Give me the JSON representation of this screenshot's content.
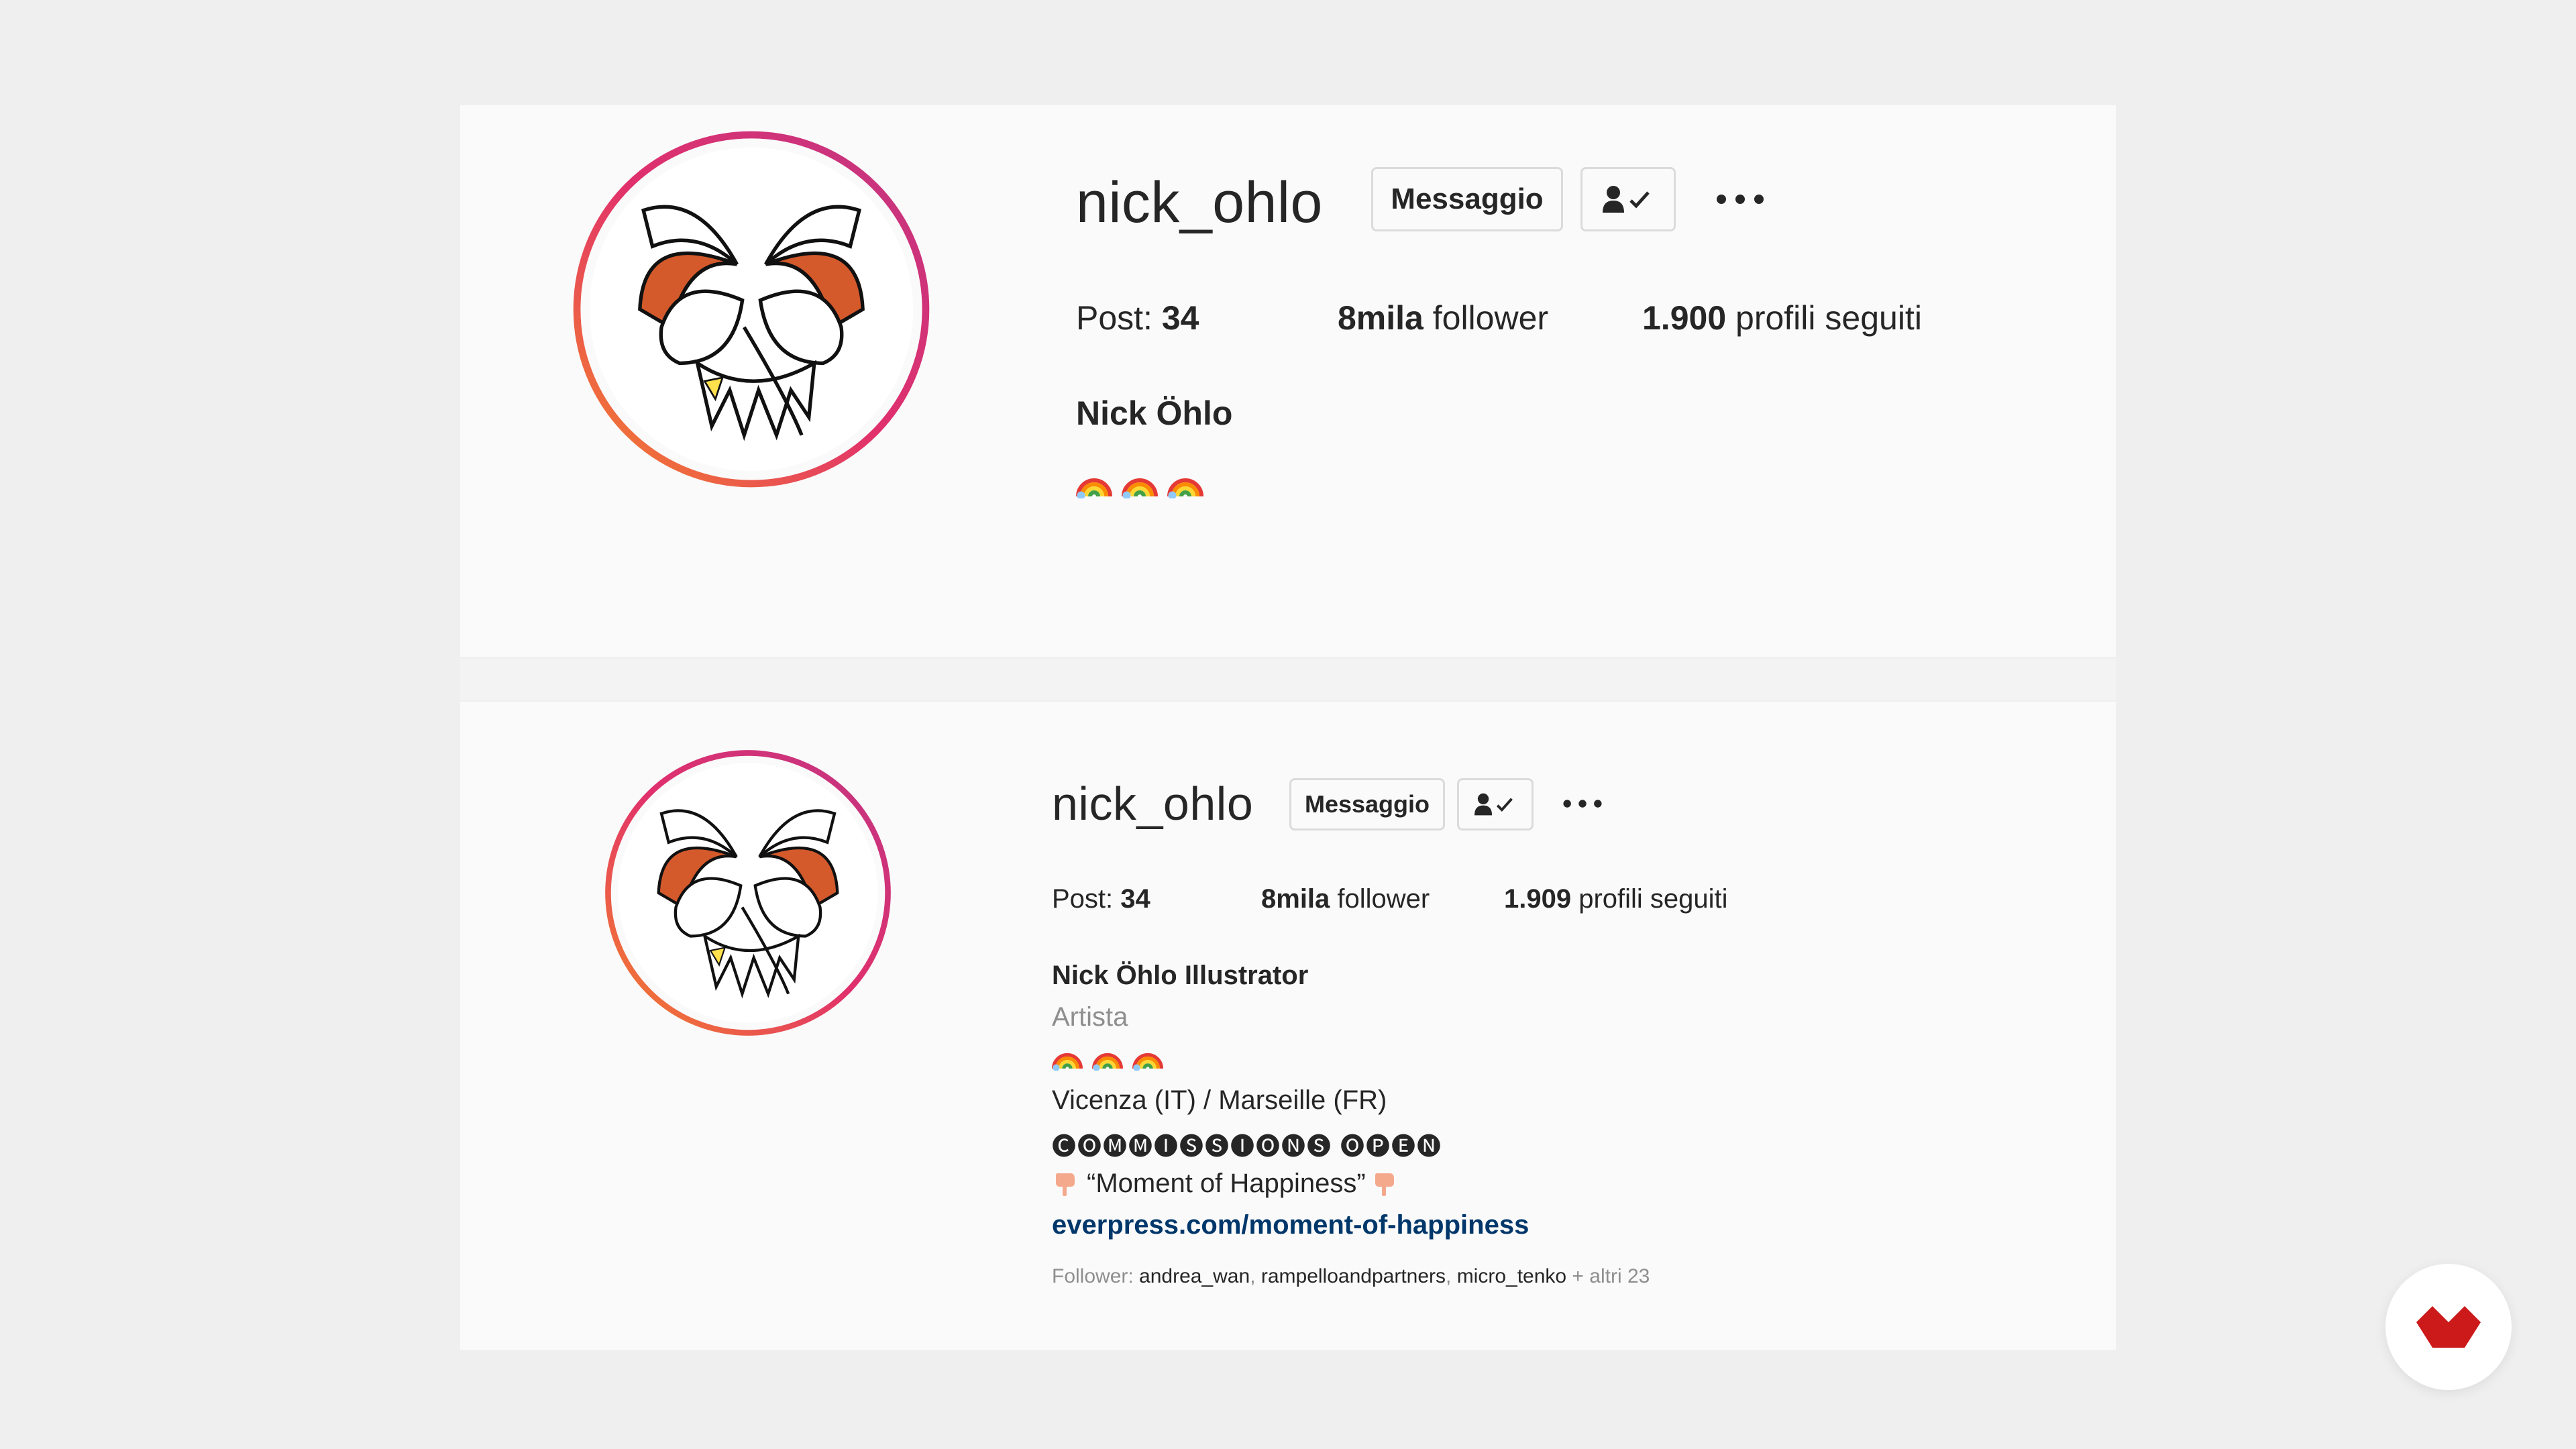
{
  "top_profile": {
    "username": "nick_ohlo",
    "message_label": "Messaggio",
    "stats": {
      "posts_label": "Post: ",
      "posts_value": "34",
      "followers_value": "8mila",
      "followers_label": " follower",
      "following_value": "1.900",
      "following_label": " profili seguiti"
    },
    "full_name": "Nick Öhlo",
    "bio_emoji": [
      "rainbow",
      "rainbow",
      "rainbow"
    ]
  },
  "bottom_profile": {
    "username": "nick_ohlo",
    "message_label": "Messaggio",
    "stats": {
      "posts_label": "Post: ",
      "posts_value": "34",
      "followers_value": "8mila",
      "followers_label": " follower",
      "following_value": "1.909",
      "following_label": " profili seguiti"
    },
    "full_name": "Nick Öhlo Illustrator",
    "category": "Artista",
    "bio_emoji": [
      "rainbow",
      "rainbow",
      "rainbow"
    ],
    "location": "Vicenza (IT) / Marseille (FR)",
    "commissions": "🅒🅞🅜🅜🅘🅢🅢🅘🅞🅝🅢 🅞🅟🅔🅝",
    "moment_text": "“Moment of Happiness”",
    "website": "everpress.com/moment-of-happiness",
    "followed_by": {
      "label": "Follower: ",
      "names": [
        "andrea_wan",
        "rampelloandpartners",
        "micro_tenko"
      ],
      "others": " + altri 23"
    }
  },
  "icons": {
    "following": "person-check-icon",
    "more": "more-horizontal-icon",
    "pointing": "backhand-index-pointing-down-icon",
    "corner": "red-heart-logo-icon"
  },
  "colors": {
    "ring_start": "#f58529",
    "ring_end": "#dd2a7b",
    "link": "#00376b",
    "logo_red": "#cc1a1a"
  }
}
